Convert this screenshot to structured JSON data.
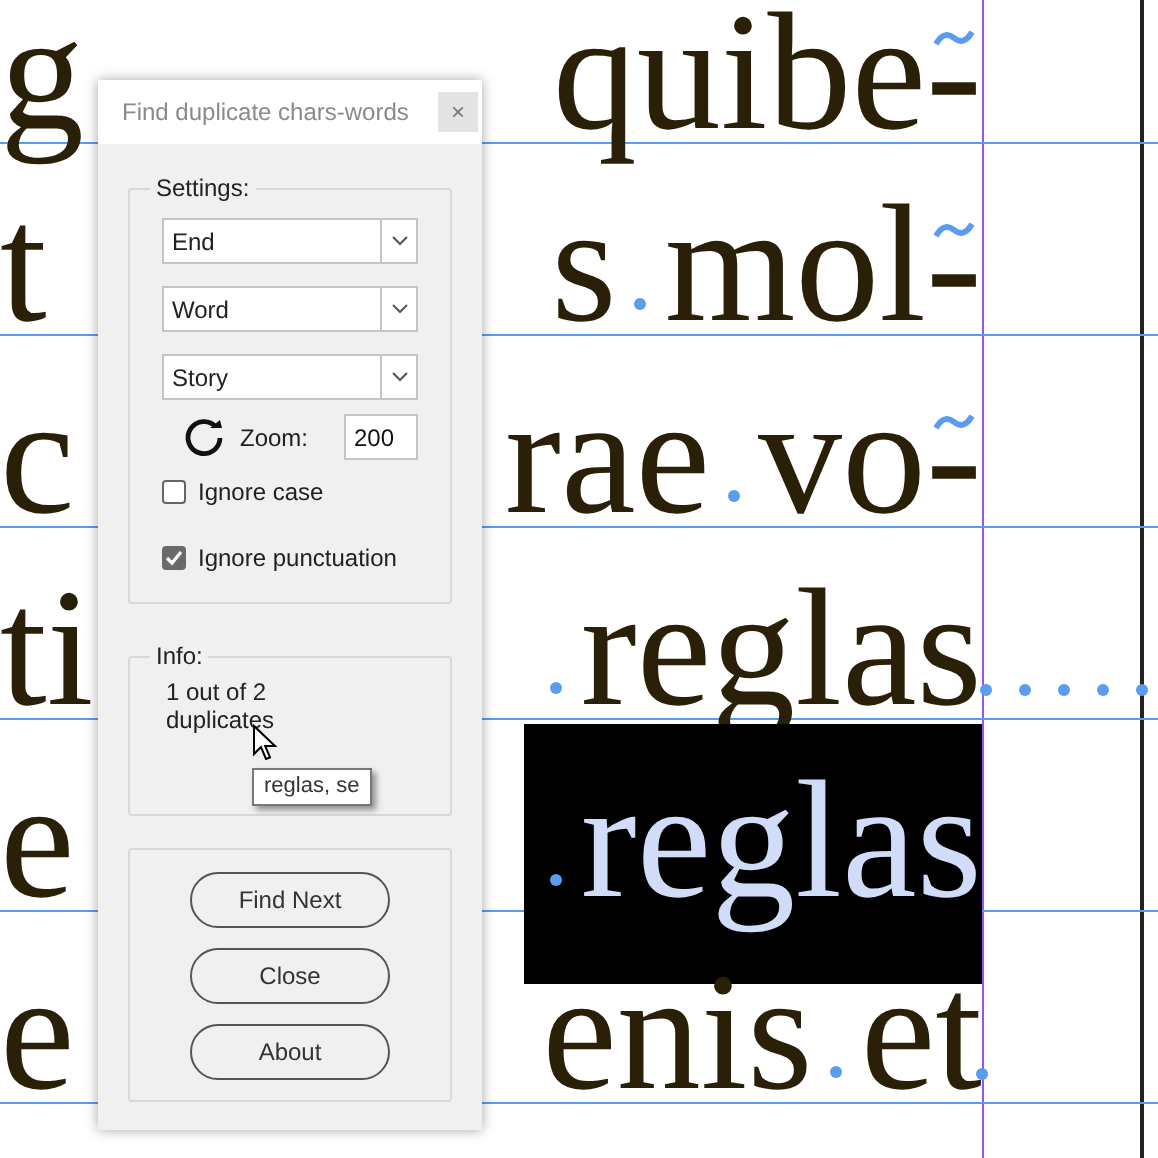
{
  "document": {
    "lines": [
      {
        "left": "g",
        "words": [
          "quibe-"
        ],
        "hyphen_mark": true,
        "selected": false
      },
      {
        "left": "t",
        "words": [
          "s",
          "mol-"
        ],
        "hyphen_mark": true,
        "selected": false
      },
      {
        "left": "c",
        "words": [
          "rae",
          "vo-"
        ],
        "hyphen_mark": true,
        "selected": false
      },
      {
        "left": "ti",
        "words": [
          "reglas"
        ],
        "leading_space": true,
        "overflow": true,
        "selected": false
      },
      {
        "left": "e",
        "words": [
          "reglas"
        ],
        "leading_space": true,
        "selected": true
      },
      {
        "left": "e",
        "words": [
          "enis",
          "et"
        ],
        "trailing_space": true,
        "selected": false
      }
    ]
  },
  "dialog": {
    "title": "Find duplicate chars-words",
    "close": "×",
    "settings": {
      "legend": "Settings:",
      "dropdowns": [
        "End",
        "Word",
        "Story"
      ],
      "zoom_label": "Zoom:",
      "zoom_value": "200",
      "checkboxes": [
        {
          "label": "Ignore case",
          "checked": false
        },
        {
          "label": "Ignore punctuation",
          "checked": true
        }
      ]
    },
    "info": {
      "legend": "Info:",
      "text": "1 out of 2 duplicates",
      "tooltip": "reglas, se"
    },
    "buttons": [
      "Find Next",
      "Close",
      "About"
    ]
  }
}
